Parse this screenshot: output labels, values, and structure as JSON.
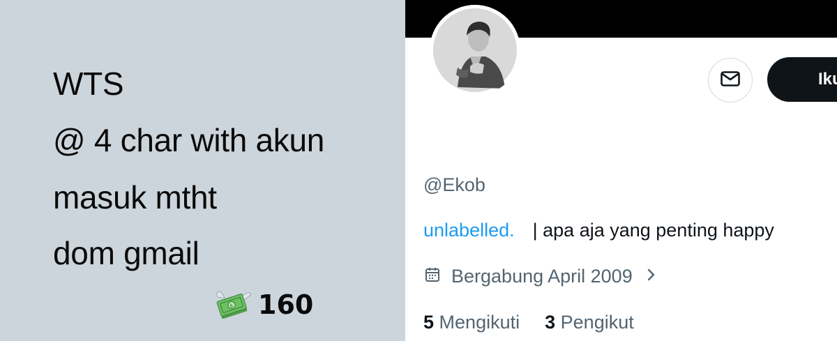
{
  "promo": {
    "lines": [
      "WTS",
      "@ 4 char with akun",
      "masuk mtht",
      "dom gmail"
    ],
    "price": "160",
    "price_icon": "money-with-wings-icon"
  },
  "profile": {
    "follow_label": "Ikuti",
    "handle": "@Ekob",
    "bio_link": "unlabelled.",
    "bio_text": "| apa aja yang penting happy",
    "joined": "Bergabung April 2009",
    "following_count": "5",
    "following_label": "Mengikuti",
    "followers_count": "3",
    "followers_label": "Pengikut"
  },
  "colors": {
    "promo_bg": "#cdd5dc",
    "banner": "#000000",
    "link": "#1d9bf0",
    "secondary_text": "#536471",
    "follow_button": "#0f1419"
  }
}
